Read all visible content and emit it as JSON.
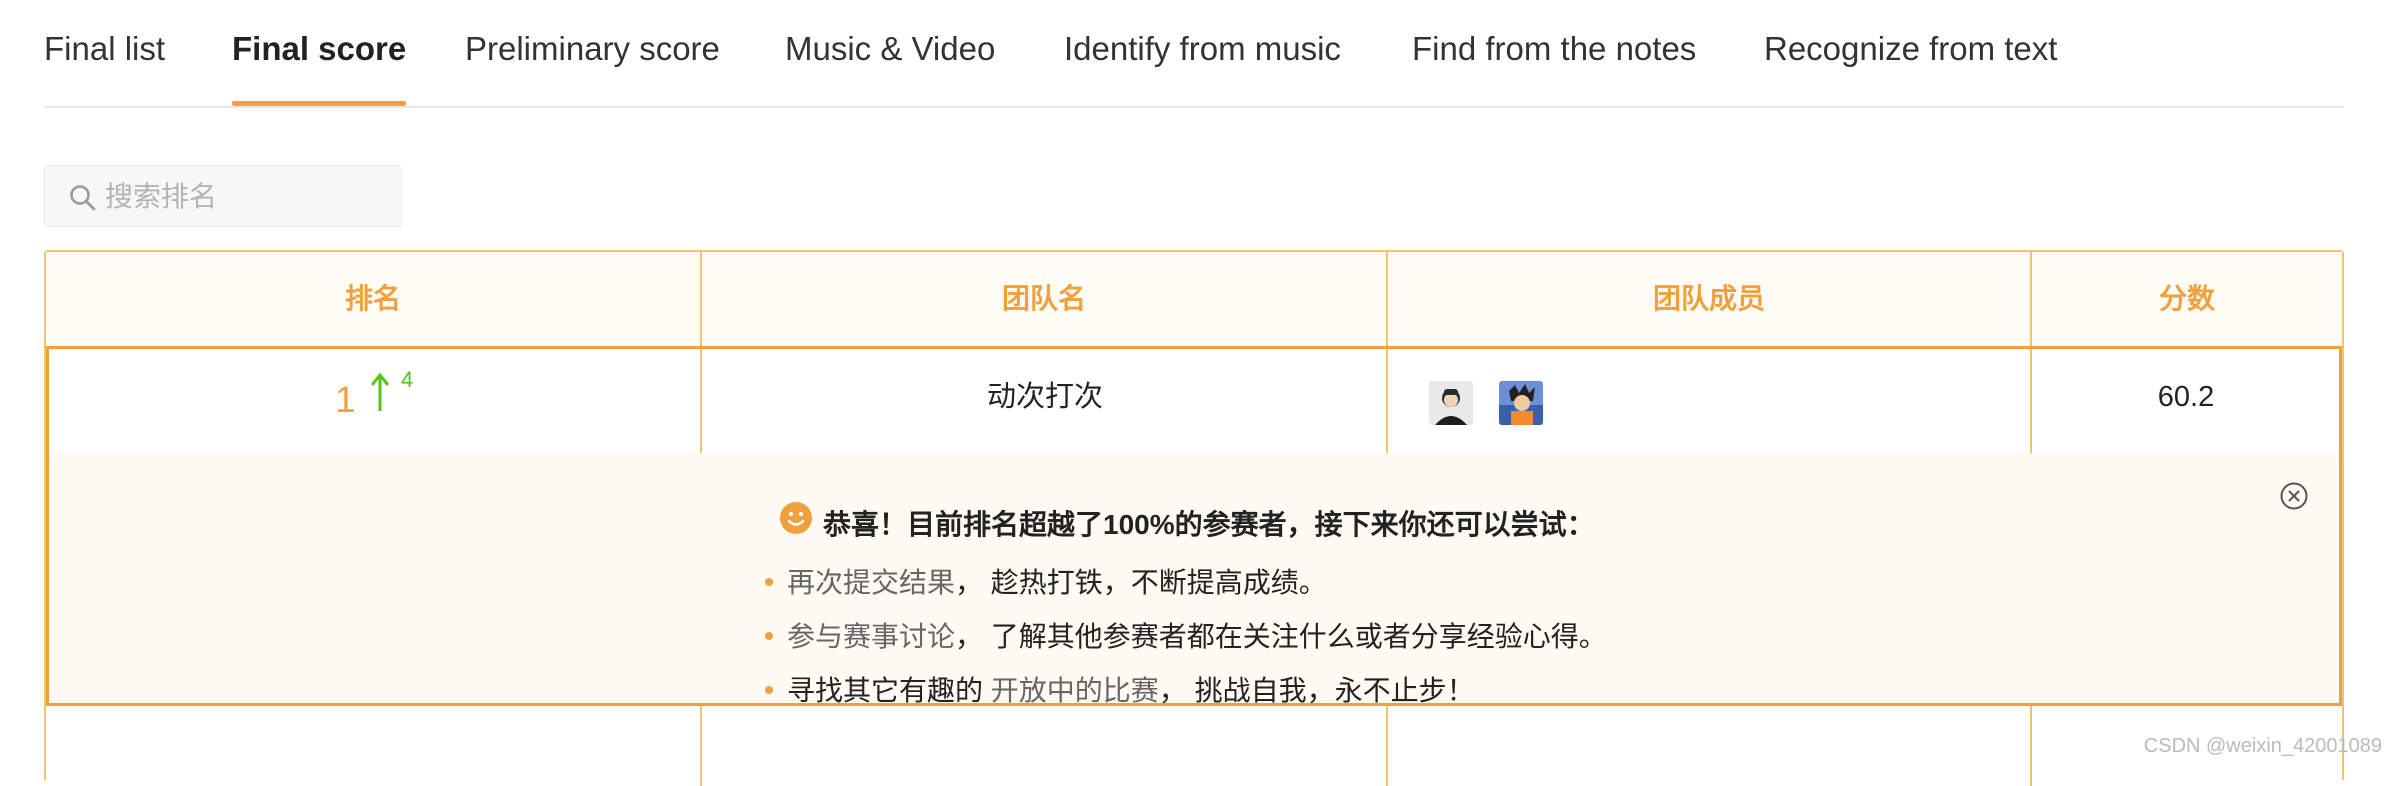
{
  "tabs": [
    {
      "label": "Final list"
    },
    {
      "label": "Final score"
    },
    {
      "label": "Preliminary score"
    },
    {
      "label": "Music & Video"
    },
    {
      "label": "Identify from music"
    },
    {
      "label": "Find from the notes"
    },
    {
      "label": "Recognize from text"
    }
  ],
  "active_tab": "Final score",
  "search": {
    "placeholder": "搜索排名",
    "value": "",
    "icon": "search-icon"
  },
  "table": {
    "headers": [
      "排名",
      "团队名",
      "团队成员",
      "分数"
    ],
    "rows": [
      {
        "rank": "1",
        "rank_change": "4",
        "team_name": "动次打次",
        "members": [
          "avatar-1",
          "avatar-2"
        ],
        "score": "60.2"
      }
    ]
  },
  "tip": {
    "title": "恭喜！目前排名超越了100%的参赛者，接下来你还可以尝试：",
    "items": [
      {
        "link": "再次提交结果",
        "text": "， 趁热打铁，不断提高成绩。",
        "prefix": ""
      },
      {
        "link": "参与赛事讨论",
        "text": "， 了解其他参赛者都在关注什么或者分享经验心得。",
        "prefix": ""
      },
      {
        "prefix": "寻找其它有趣的 ",
        "link": "开放中的比赛",
        "text": "， 挑战自我，永不止步！"
      }
    ]
  },
  "watermark": "CSDN @weixin_42001089",
  "colors": {
    "accent": "#f0a03c",
    "border": "#f3c26a",
    "up": "#52c41a"
  }
}
